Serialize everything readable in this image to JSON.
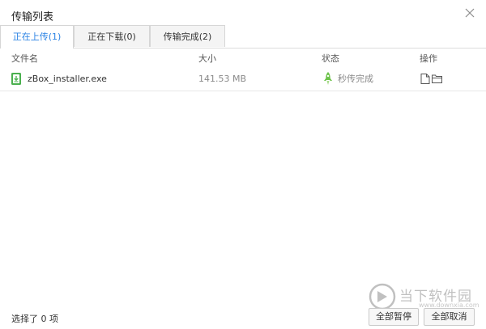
{
  "window": {
    "title": "传输列表"
  },
  "tabs": [
    {
      "label": "正在上传(1)",
      "active": true
    },
    {
      "label": "正在下载(0)",
      "active": false
    },
    {
      "label": "传输完成(2)",
      "active": false
    }
  ],
  "columns": {
    "name": "文件名",
    "size": "大小",
    "status": "状态",
    "action": "操作"
  },
  "rows": [
    {
      "name": "zBox_installer.exe",
      "size": "141.53 MB",
      "status": "秒传完成",
      "status_icon": "rocket-icon",
      "file_icon": "exe-file-icon"
    }
  ],
  "footer": {
    "selection_text": "选择了 0 项",
    "pause_all_label": "全部暂停",
    "cancel_all_label": "全部取消"
  },
  "watermark": {
    "name": "当下软件园",
    "url": "www.downxia.com"
  },
  "colors": {
    "accent": "#2a82e4",
    "success": "#6cc24a"
  }
}
